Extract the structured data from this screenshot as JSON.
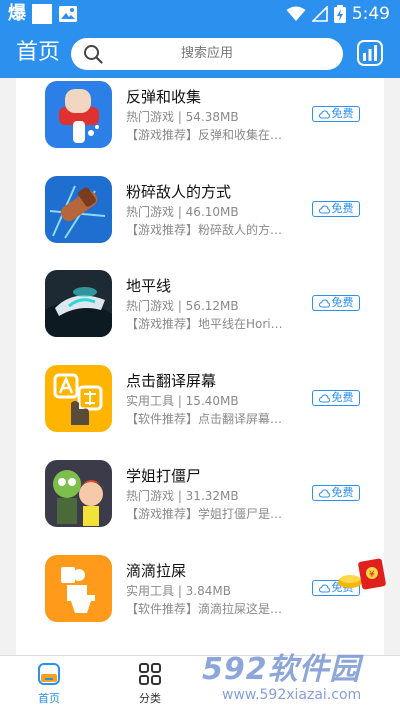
{
  "status_bar": {
    "time": "5:49",
    "left_logo": "爆"
  },
  "header": {
    "brand": "首页",
    "search_placeholder": "搜索应用"
  },
  "apps": [
    {
      "name": "反弹和收集",
      "meta": "热门游戏 | 54.38MB",
      "desc": "【游戏推荐】反弹和收集在…",
      "button": "免费",
      "icon": "bounce-collect-icon"
    },
    {
      "name": "粉碎敌人的方式",
      "meta": "热门游戏 | 46.10MB",
      "desc": "【游戏推荐】粉碎敌人的方…",
      "button": "免费",
      "icon": "crush-enemy-icon"
    },
    {
      "name": "地平线",
      "meta": "热门游戏 | 56.12MB",
      "desc": "【游戏推荐】地平线在Hori…",
      "button": "免费",
      "icon": "horizon-icon"
    },
    {
      "name": "点击翻译屏幕",
      "meta": "实用工具 | 15.40MB",
      "desc": "【软件推荐】点击翻译屏幕…",
      "button": "免费",
      "icon": "translate-icon"
    },
    {
      "name": "学姐打僵尸",
      "meta": "热门游戏 | 31.32MB",
      "desc": "【游戏推荐】学姐打僵尸是…",
      "button": "免费",
      "icon": "zombie-icon"
    },
    {
      "name": "滴滴拉屎",
      "meta": "实用工具 | 3.84MB",
      "desc": "【软件推荐】滴滴拉屎这是…",
      "button": "免费",
      "icon": "toilet-icon"
    }
  ],
  "tabs": [
    {
      "label": "首页",
      "active": true
    },
    {
      "label": "分类",
      "active": false
    }
  ],
  "watermark": {
    "big": "592软件园",
    "small": "www.592xiazai.com"
  },
  "colors": {
    "primary": "#2b90ee",
    "text": "#111111",
    "secondary_text": "#8a8a8a"
  }
}
